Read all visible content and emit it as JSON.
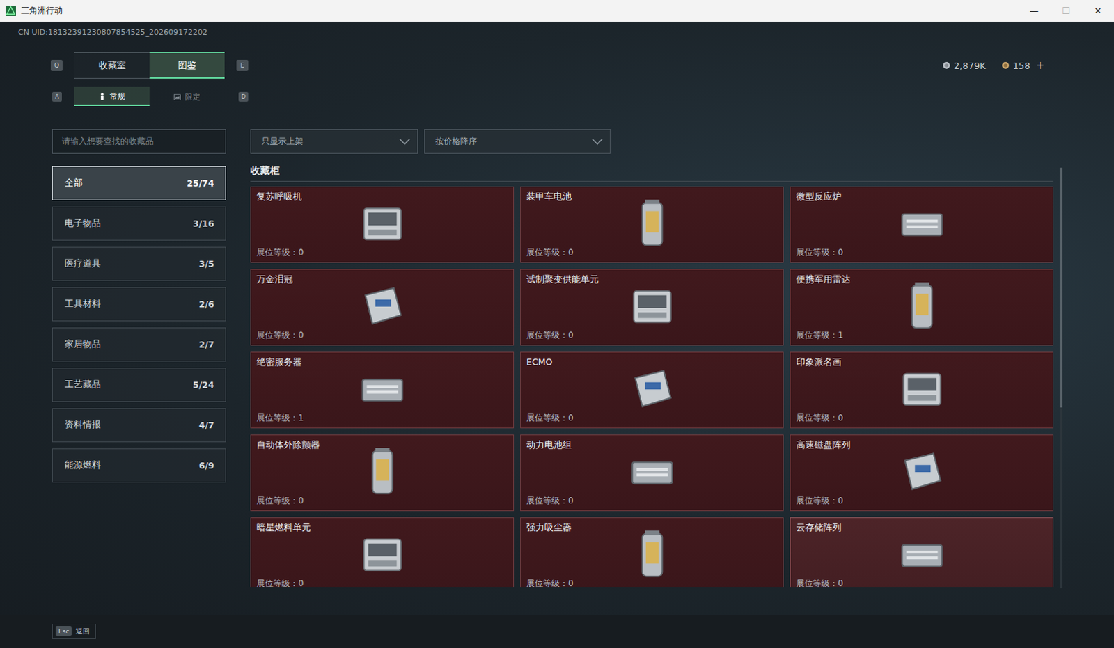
{
  "window": {
    "title": "三角洲行动",
    "controls": [
      "—",
      "☐",
      "✕"
    ]
  },
  "uid": "CN UID:18132391230807854525_202609172202",
  "currency": [
    {
      "value": "2,879K"
    },
    {
      "value": "158"
    }
  ],
  "currency_add": "+",
  "tabs": {
    "prev_key": "Q",
    "next_key": "E",
    "items": [
      {
        "label": "收藏室",
        "selected": false
      },
      {
        "label": "图鉴",
        "selected": true
      }
    ]
  },
  "subtabs": {
    "prev_key": "A",
    "next_key": "D",
    "items": [
      {
        "label": "常规",
        "selected": true
      },
      {
        "label": "限定",
        "selected": false
      }
    ]
  },
  "search": {
    "placeholder": "请输入想要查找的收藏品"
  },
  "filters": [
    {
      "label": "只显示上架"
    },
    {
      "label": "按价格降序"
    }
  ],
  "categories": [
    {
      "label": "全部",
      "count": "25/74",
      "selected": true
    },
    {
      "label": "电子物品",
      "count": "3/16",
      "selected": false
    },
    {
      "label": "医疗道具",
      "count": "3/5",
      "selected": false
    },
    {
      "label": "工具材料",
      "count": "2/6",
      "selected": false
    },
    {
      "label": "家居物品",
      "count": "2/7",
      "selected": false
    },
    {
      "label": "工艺藏品",
      "count": "5/24",
      "selected": false
    },
    {
      "label": "资料情报",
      "count": "4/7",
      "selected": false
    },
    {
      "label": "能源燃料",
      "count": "6/9",
      "selected": false
    }
  ],
  "section_title": "收藏柜",
  "level_label": "展位等级：",
  "items": [
    {
      "name": "复苏呼吸机",
      "level": "0",
      "highlighted": false
    },
    {
      "name": "装甲车电池",
      "level": "0",
      "highlighted": false
    },
    {
      "name": "微型反应炉",
      "level": "0",
      "highlighted": false
    },
    {
      "name": "万金泪冠",
      "level": "0",
      "highlighted": false
    },
    {
      "name": "试制聚变供能单元",
      "level": "0",
      "highlighted": false
    },
    {
      "name": "便携军用雷达",
      "level": "1",
      "highlighted": false
    },
    {
      "name": "绝密服务器",
      "level": "1",
      "highlighted": false
    },
    {
      "name": "ECMO",
      "level": "0",
      "highlighted": false
    },
    {
      "name": "印象派名画",
      "level": "0",
      "highlighted": false
    },
    {
      "name": "自动体外除颤器",
      "level": "0",
      "highlighted": false
    },
    {
      "name": "动力电池组",
      "level": "0",
      "highlighted": false
    },
    {
      "name": "高速磁盘阵列",
      "level": "0",
      "highlighted": false
    },
    {
      "name": "暗星燃料单元",
      "level": "0",
      "highlighted": false
    },
    {
      "name": "强力吸尘器",
      "level": "0",
      "highlighted": false
    },
    {
      "name": "云存储阵列",
      "level": "0",
      "highlighted": true
    }
  ],
  "scrollbar": {
    "level": 0.57
  },
  "footer": {
    "key": "Esc",
    "label": "返回"
  }
}
